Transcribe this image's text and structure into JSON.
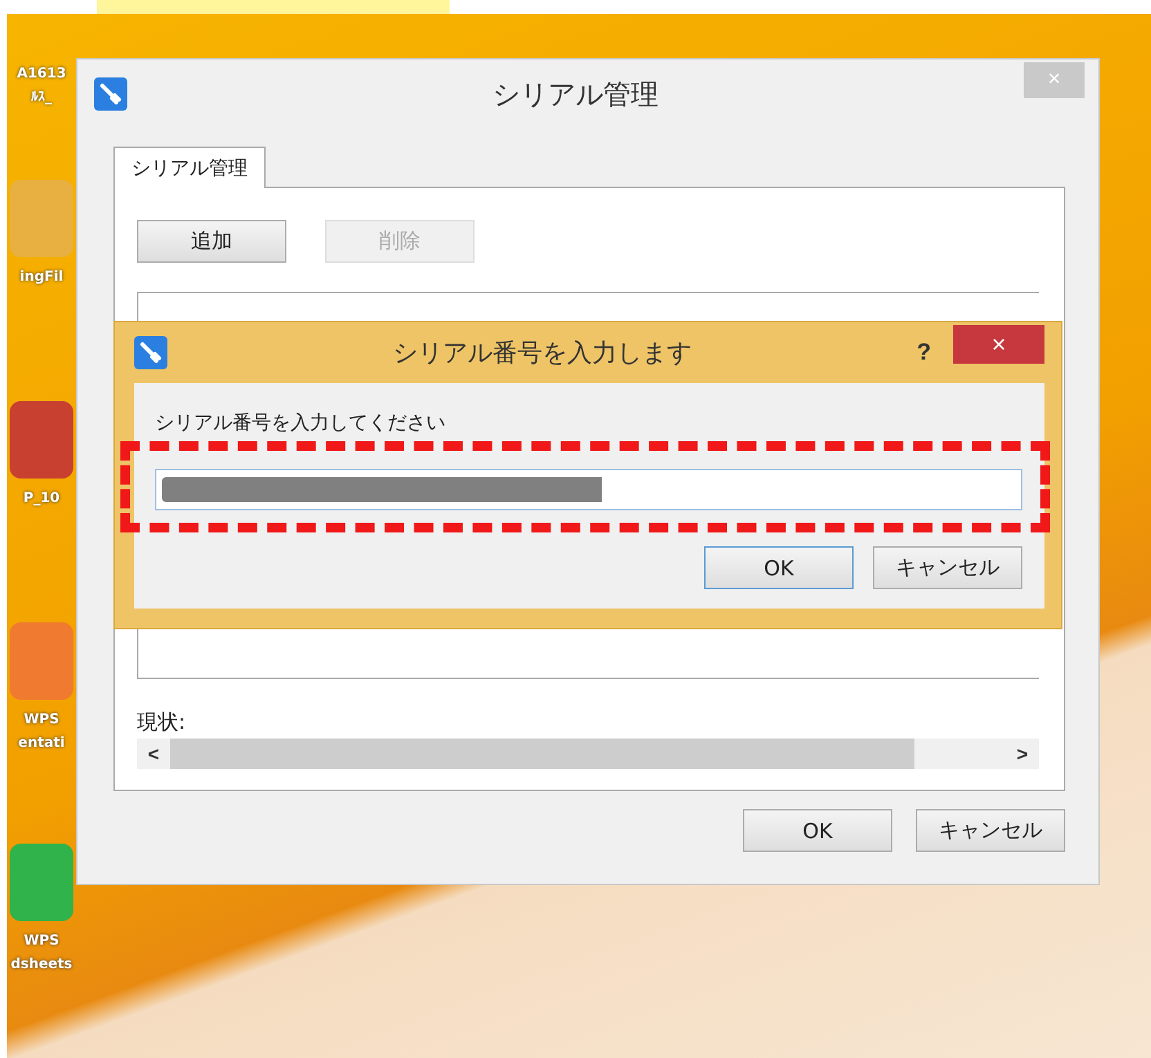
{
  "desktop_icons": [
    {
      "labels": [
        "A1613",
        "ﾙｽ_"
      ]
    },
    {
      "labels": [
        "ingFil"
      ],
      "color": "#e8b040"
    },
    {
      "labels": [
        "P_10"
      ],
      "color": "#c84030"
    },
    {
      "labels": [
        "WPS",
        "entati"
      ],
      "color": "#f07a30"
    },
    {
      "labels": [
        "WPS",
        "dsheets"
      ],
      "color": "#2fb34a"
    }
  ],
  "main_window": {
    "title": "シリアル管理",
    "close": "×",
    "tabs": [
      {
        "label": "シリアル管理",
        "selected": true
      }
    ],
    "buttons": [
      {
        "label": "追加",
        "disabled": false
      },
      {
        "label": "削除",
        "disabled": true
      }
    ],
    "status_label": "現状:",
    "scroll_left": "<",
    "scroll_right": ">",
    "footer_buttons": [
      {
        "label": "OK",
        "default": false
      },
      {
        "label": "キャンセル",
        "default": false
      }
    ]
  },
  "input_dialog": {
    "title": "シリアル番号を入力します",
    "help": "?",
    "close": "×",
    "prompt": "シリアル番号を入力してください",
    "value_redacted": true,
    "highlighted": true,
    "buttons": [
      {
        "label": "OK",
        "default": true
      },
      {
        "label": "キャンセル",
        "default": false
      }
    ]
  }
}
